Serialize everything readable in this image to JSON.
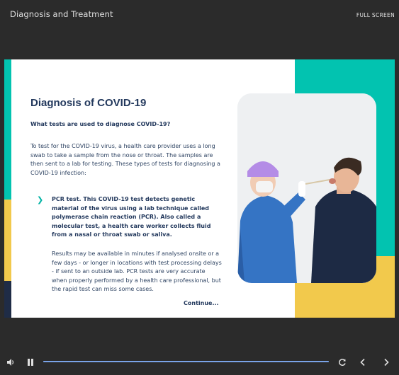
{
  "header": {
    "title": "Diagnosis and Treatment",
    "fullscreen_label": "FULL SCREEN"
  },
  "slide": {
    "heading": "Diagnosis of COVID-19",
    "subheading": "What tests are used to diagnose COVID-19?",
    "intro": "To test for the COVID-19 virus, a health care provider uses a long swab to take a sample from the nose or throat. The samples are then sent to a lab for testing. These types of tests for diagnosing a COVID-19 infection:",
    "bullet": "PCR test. This COVID-19 test detects genetic material of the virus using a lab technique called polymerase chain reaction (PCR). Also called a molecular test, a health care worker collects fluid from a nasal or throat swab or saliva.",
    "results": "Results may be available in minutes if analysed onsite or a few days - or longer in locations with test processing delays - if sent to an outside lab. PCR tests are very accurate when properly performed by a health care professional, but the rapid test can miss some cases.",
    "continue_label": "Continue..."
  },
  "player": {
    "progress_fraction": 1.0
  },
  "colors": {
    "teal": "#02c3b0",
    "yellow": "#f2c94c",
    "navy": "#23395d",
    "progress": "#5f87c8"
  },
  "icons": [
    "volume-icon",
    "pause-icon",
    "replay-icon",
    "previous-icon",
    "next-icon",
    "chevron-right-icon"
  ]
}
